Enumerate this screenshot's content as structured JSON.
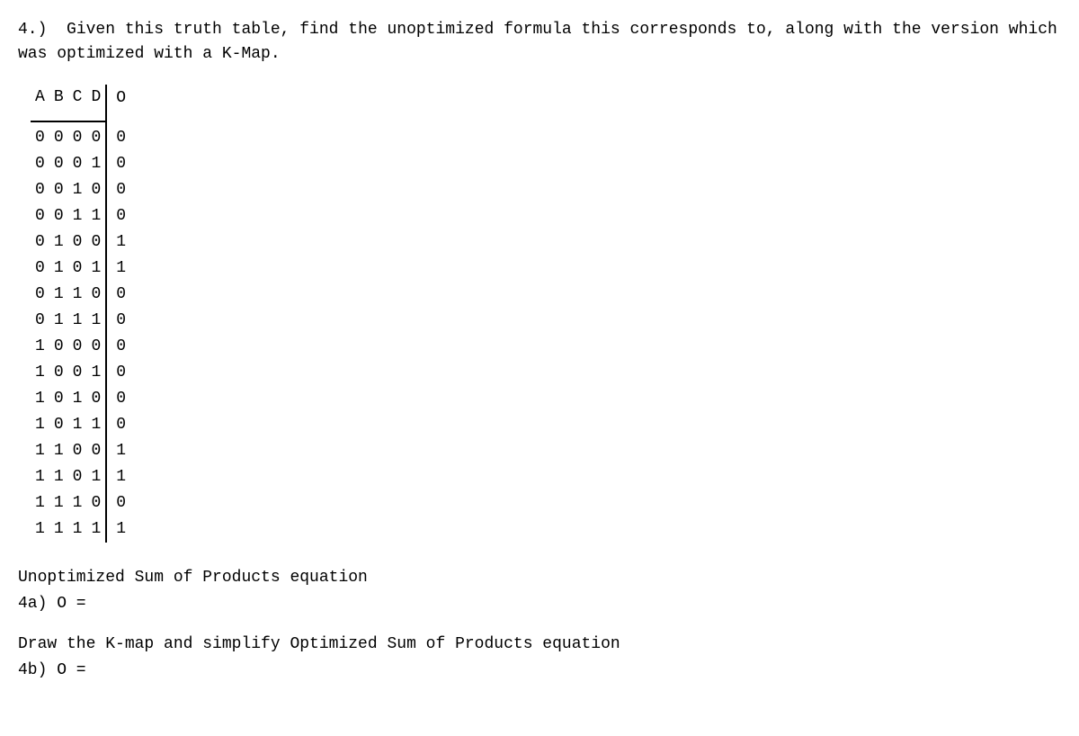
{
  "question": {
    "number": "4.)",
    "prompt": "Given this truth table, find the unoptimized formula this corresponds to, along with the version which was optimized with a K-Map."
  },
  "table": {
    "headers": [
      "A",
      "B",
      "C",
      "D",
      "O"
    ],
    "rows": [
      {
        "a": "0",
        "b": "0",
        "c": "0",
        "d": "0",
        "o": "0"
      },
      {
        "a": "0",
        "b": "0",
        "c": "0",
        "d": "1",
        "o": "0"
      },
      {
        "a": "0",
        "b": "0",
        "c": "1",
        "d": "0",
        "o": "0"
      },
      {
        "a": "0",
        "b": "0",
        "c": "1",
        "d": "1",
        "o": "0"
      },
      {
        "a": "0",
        "b": "1",
        "c": "0",
        "d": "0",
        "o": "1"
      },
      {
        "a": "0",
        "b": "1",
        "c": "0",
        "d": "1",
        "o": "1"
      },
      {
        "a": "0",
        "b": "1",
        "c": "1",
        "d": "0",
        "o": "0"
      },
      {
        "a": "0",
        "b": "1",
        "c": "1",
        "d": "1",
        "o": "0"
      },
      {
        "a": "1",
        "b": "0",
        "c": "0",
        "d": "0",
        "o": "0"
      },
      {
        "a": "1",
        "b": "0",
        "c": "0",
        "d": "1",
        "o": "0"
      },
      {
        "a": "1",
        "b": "0",
        "c": "1",
        "d": "0",
        "o": "0"
      },
      {
        "a": "1",
        "b": "0",
        "c": "1",
        "d": "1",
        "o": "0"
      },
      {
        "a": "1",
        "b": "1",
        "c": "0",
        "d": "0",
        "o": "1"
      },
      {
        "a": "1",
        "b": "1",
        "c": "0",
        "d": "1",
        "o": "1"
      },
      {
        "a": "1",
        "b": "1",
        "c": "1",
        "d": "0",
        "o": "0"
      },
      {
        "a": "1",
        "b": "1",
        "c": "1",
        "d": "1",
        "o": "1"
      }
    ]
  },
  "parts": {
    "a": {
      "label": "Unoptimized Sum of Products equation",
      "prompt": "4a) O ="
    },
    "b": {
      "label": "Draw the K-map and simplify Optimized Sum of Products equation",
      "prompt": "4b) O ="
    }
  }
}
